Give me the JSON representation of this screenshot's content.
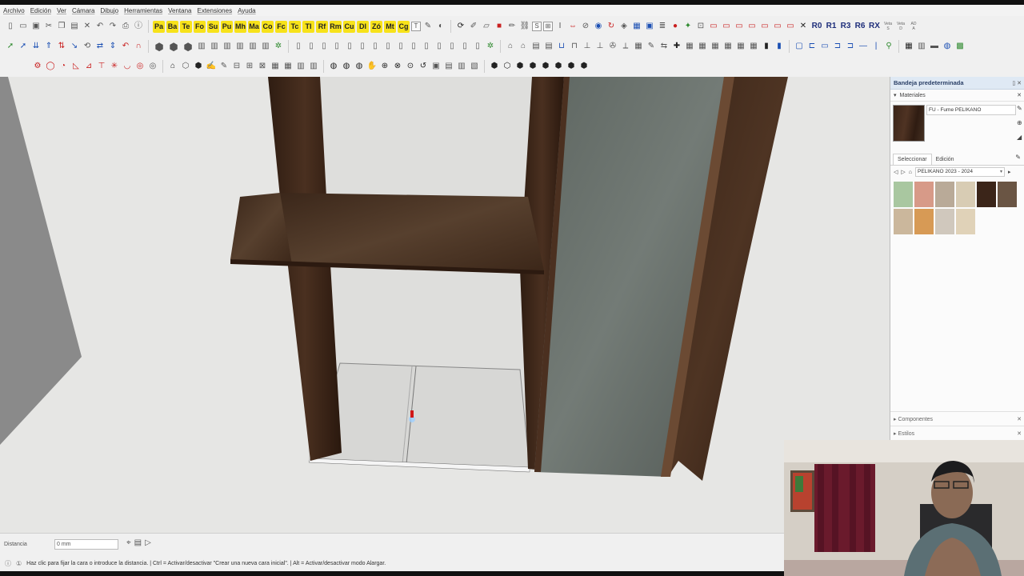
{
  "menu": [
    "Archivo",
    "Edición",
    "Ver",
    "Cámara",
    "Dibujo",
    "Herramientas",
    "Ventana",
    "Extensiones",
    "Ayuda"
  ],
  "toolbar1_labels": [
    "Pa",
    "Ba",
    "Te",
    "Fo",
    "Su",
    "Pu",
    "Mh",
    "Ma",
    "Co",
    "Fc",
    "Tc",
    "Tl",
    "Rf",
    "Rm",
    "Cu",
    "Dl",
    "Zó",
    "Mt",
    "Cg"
  ],
  "toolbar1_right": [
    "R0",
    "R1",
    "R3",
    "R6",
    "RX"
  ],
  "toolbar1_tiny": [
    "Veta\nS",
    "Veta\nD",
    "AD\nA"
  ],
  "status": {
    "distance_label": "Distancia",
    "distance_value": "0 mm",
    "hint": "Haz clic para fijar la cara o introduce la distancia. | Ctrl = Activar/desactivar \"Crear una nueva cara inicial\". | Alt = Activar/desactivar modo Alargar."
  },
  "tray": {
    "title": "Bandeja predeterminada",
    "materials_label": "Materiales",
    "material_name": "FU - Fume PELIKANO",
    "tab_select": "Seleccionar",
    "tab_edit": "Edición",
    "library": "PELIKANO 2023 - 2024",
    "components_label": "Componentes",
    "styles_label": "Estilos"
  },
  "swatch_colors": [
    "#a9c7a0",
    "#d79a88",
    "#b9aa98",
    "#d8ccb4",
    "#3b2519",
    "#6a5544",
    "#cbb79c",
    "#d79a55",
    "#d0c8bd",
    "#e0d2b8"
  ],
  "selected_material_color": "#3a2418"
}
